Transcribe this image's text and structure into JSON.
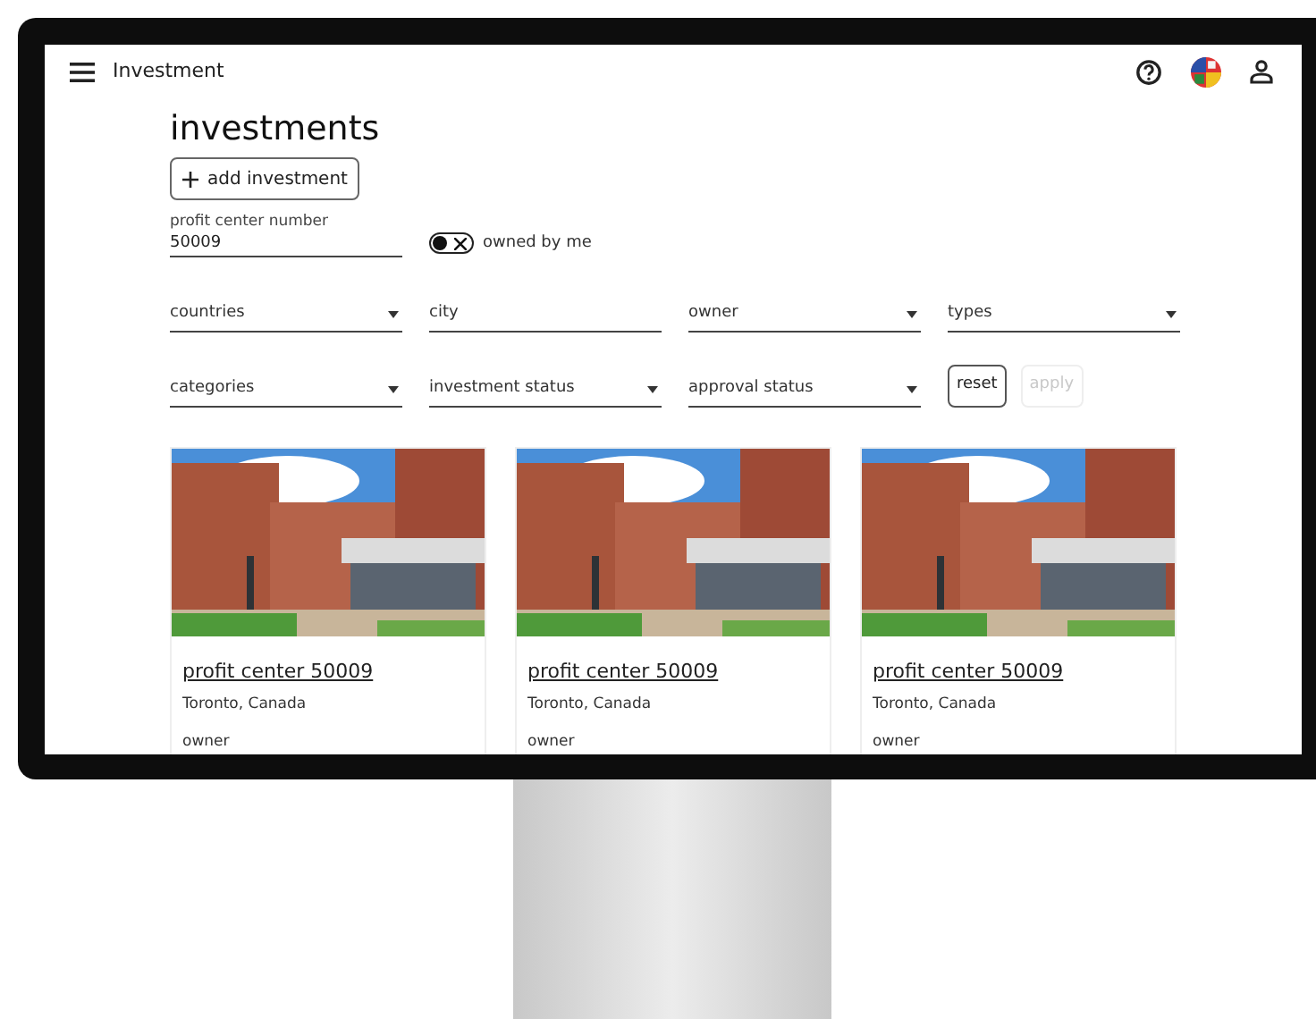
{
  "app_bar": {
    "title": "Investment"
  },
  "page_title": "investments",
  "add_button": {
    "label": "add investment"
  },
  "profit_center": {
    "label": "profit center number",
    "value": "50009"
  },
  "owned_by_me": {
    "label": "owned by me",
    "on": false
  },
  "filters": [
    {
      "label": "countries",
      "kind": "select"
    },
    {
      "label": "city",
      "kind": "text"
    },
    {
      "label": "owner",
      "kind": "select"
    },
    {
      "label": "types",
      "kind": "select"
    },
    {
      "label": "categories",
      "kind": "select"
    },
    {
      "label": "investment status",
      "kind": "select"
    },
    {
      "label": "approval status",
      "kind": "select"
    }
  ],
  "actions": [
    {
      "label": "reset",
      "disabled": false
    },
    {
      "label": "apply",
      "disabled": true
    }
  ],
  "cards": [
    {
      "kind": "picture",
      "title": "profit center 50009",
      "location": "Toronto, Canada",
      "owner_label": "owner"
    },
    {
      "kind": "picture",
      "title": "profit center 50009",
      "location": "Toronto, Canada",
      "owner_label": "owner"
    },
    {
      "kind": "picture",
      "title": "profit center 50009",
      "location": "Toronto, Canada",
      "owner_label": "owner"
    }
  ]
}
